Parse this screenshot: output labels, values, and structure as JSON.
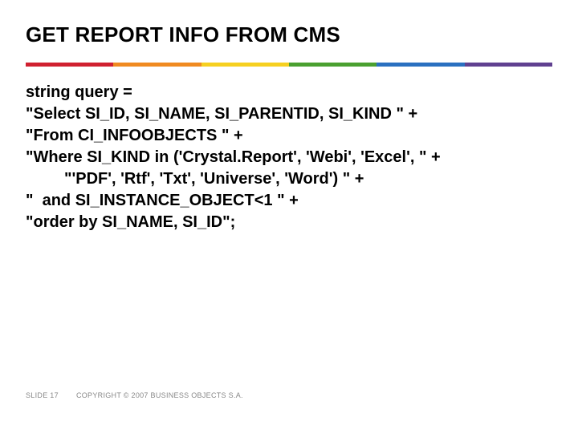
{
  "title": "GET REPORT INFO FROM CMS",
  "body": {
    "l1": "string query =",
    "l2": "\"Select SI_ID, SI_NAME, SI_PARENTID, SI_KIND \" +",
    "l3": "\"From CI_INFOOBJECTS \" +",
    "l4": "\"Where SI_KIND in ('Crystal.Report', 'Webi', 'Excel', \" +",
    "l5": "\"'PDF', 'Rtf', 'Txt', 'Universe', 'Word') \" +",
    "l6": "\"  and SI_INSTANCE_OBJECT<1 \" +",
    "l7": "\"order by SI_NAME, SI_ID\";"
  },
  "footer": {
    "slide_label": "SLIDE 17",
    "copyright": "COPYRIGHT © 2007 BUSINESS OBJECTS S.A."
  }
}
